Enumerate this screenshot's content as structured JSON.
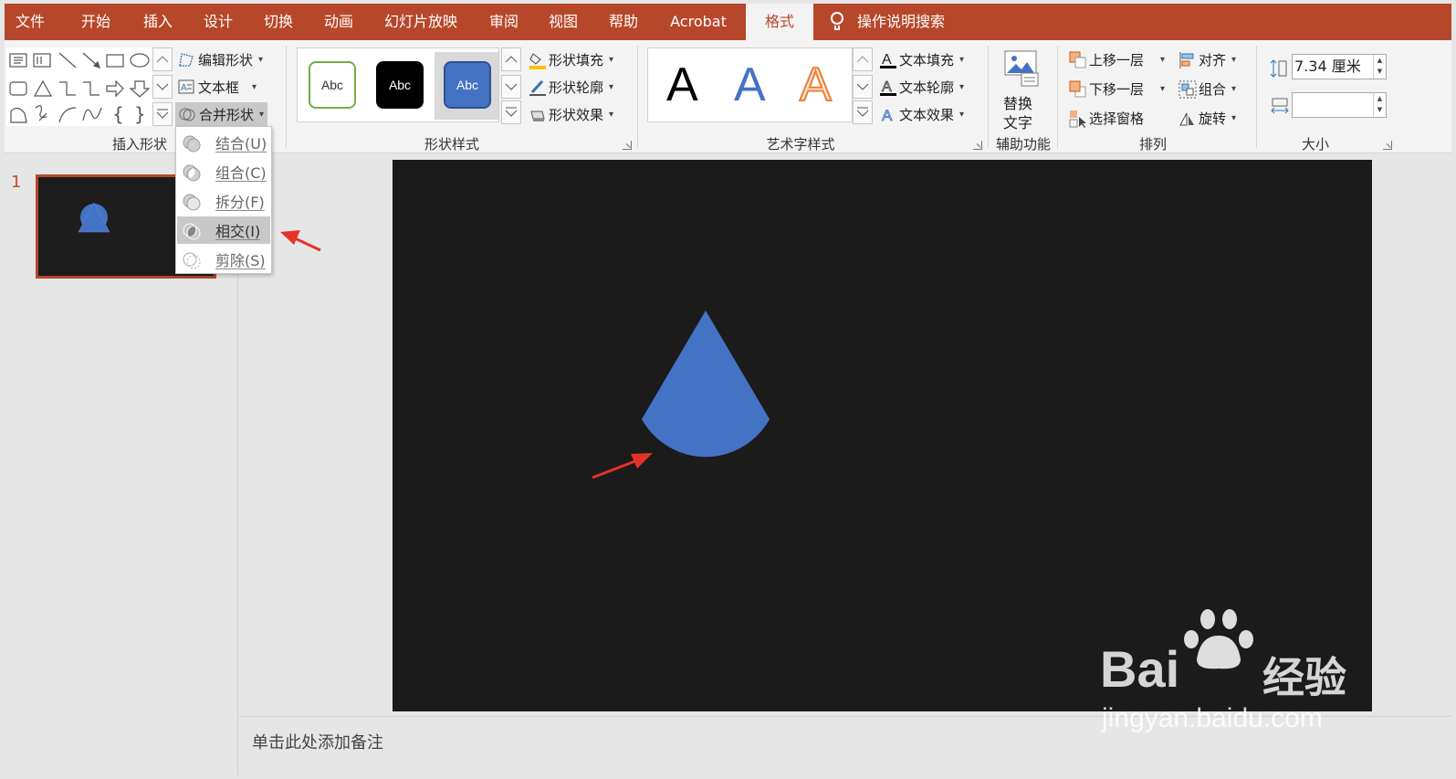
{
  "tabs": [
    "文件",
    "开始",
    "插入",
    "设计",
    "切换",
    "动画",
    "幻灯片放映",
    "审阅",
    "视图",
    "帮助",
    "Acrobat",
    "格式"
  ],
  "active_tab": "格式",
  "search_label": "操作说明搜索",
  "colors": {
    "accent": "#b7472a",
    "shape_blue": "#4472c4",
    "slide_bg": "#1b1b1b",
    "arrow_red": "#e53228"
  },
  "ribbon": {
    "insert_shapes": {
      "label": "插入形状",
      "edit_shape": "编辑形状",
      "text_box": "文本框",
      "merge_shapes": "合并形状"
    },
    "shape_styles": {
      "label": "形状样式",
      "presets": [
        "Abc",
        "Abc",
        "Abc"
      ],
      "fill": "形状填充",
      "outline": "形状轮廓",
      "effects": "形状效果"
    },
    "wordart_styles": {
      "label": "艺术字样式",
      "presets": [
        "A",
        "A",
        "A"
      ],
      "text_fill": "文本填充",
      "text_outline": "文本轮廓",
      "text_effects": "文本效果"
    },
    "accessibility": {
      "label": "辅助功能",
      "alt_text_line1": "替换",
      "alt_text_line2": "文字"
    },
    "arrange": {
      "label": "排列",
      "bring_forward": "上移一层",
      "send_backward": "下移一层",
      "selection_pane": "选择窗格",
      "align": "对齐",
      "group": "组合",
      "rotate": "旋转"
    },
    "size": {
      "label": "大小",
      "height_value": "7.34 厘米",
      "width_value": ""
    }
  },
  "merge_menu": [
    {
      "label": "结合(U)",
      "icon": "union-icon"
    },
    {
      "label": "组合(C)",
      "icon": "combine-icon"
    },
    {
      "label": "拆分(F)",
      "icon": "fragment-icon"
    },
    {
      "label": "相交(I)",
      "icon": "intersect-icon",
      "selected": true
    },
    {
      "label": "剪除(S)",
      "icon": "subtract-icon"
    }
  ],
  "slide_panel": {
    "slide_number": "1"
  },
  "notes_placeholder": "单击此处添加备注",
  "watermark": {
    "brand": "Bai",
    "brand2": "经验",
    "url": "jingyan.baidu.com"
  }
}
